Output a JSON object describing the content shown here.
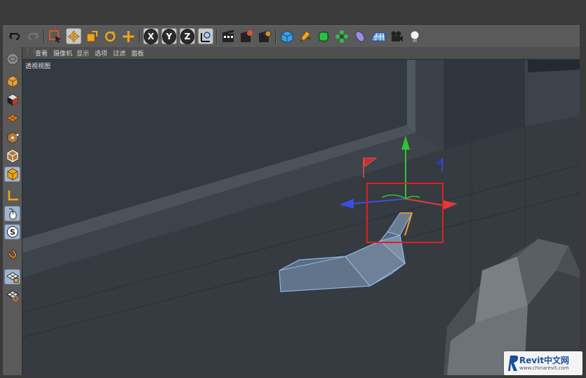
{
  "menu": {
    "items": [
      "查看",
      "摄像机",
      "显示",
      "选项",
      "过滤",
      "面板"
    ]
  },
  "viewport": {
    "label": "透视视图"
  },
  "toolbar": {
    "axis_x": "X",
    "axis_y": "Y",
    "axis_z": "Z",
    "icons": [
      "undo-icon",
      "redo-icon",
      "live-selection-icon",
      "move-icon",
      "scale-icon",
      "rotate-icon",
      "last-tool-icon",
      "x-axis-lock",
      "y-axis-lock",
      "z-axis-lock",
      "coordinate-system-icon",
      "render-view-icon",
      "render-to-picture-viewer-icon",
      "render-settings-icon",
      "cube-primitive-icon",
      "pen-spline-icon",
      "subdivision-icon",
      "array-icon",
      "deformer-icon",
      "floor-icon",
      "camera-icon",
      "light-icon"
    ]
  },
  "leftbar": {
    "icons": [
      "make-editable-icon",
      "model-mode-icon",
      "texture-mode-icon",
      "workplane-mode-icon",
      "points-mode-icon",
      "edges-mode-icon",
      "polygons-mode-icon",
      "axis-mode-icon",
      "tweak-mode-icon",
      "solo-mode-icon",
      "snap-icon",
      "workplane-lock-icon",
      "workplane-icon"
    ]
  },
  "watermark": {
    "brand": "Revit中文网",
    "url": "www.chinarevit.com"
  },
  "colors": {
    "highlight_box": "#e0201f",
    "axis_x": "#e23a3a",
    "axis_y": "#2fc52f",
    "axis_z": "#3a4fe0",
    "selected_edge": "#f0a030",
    "mesh_outline": "#8fb8e8"
  }
}
